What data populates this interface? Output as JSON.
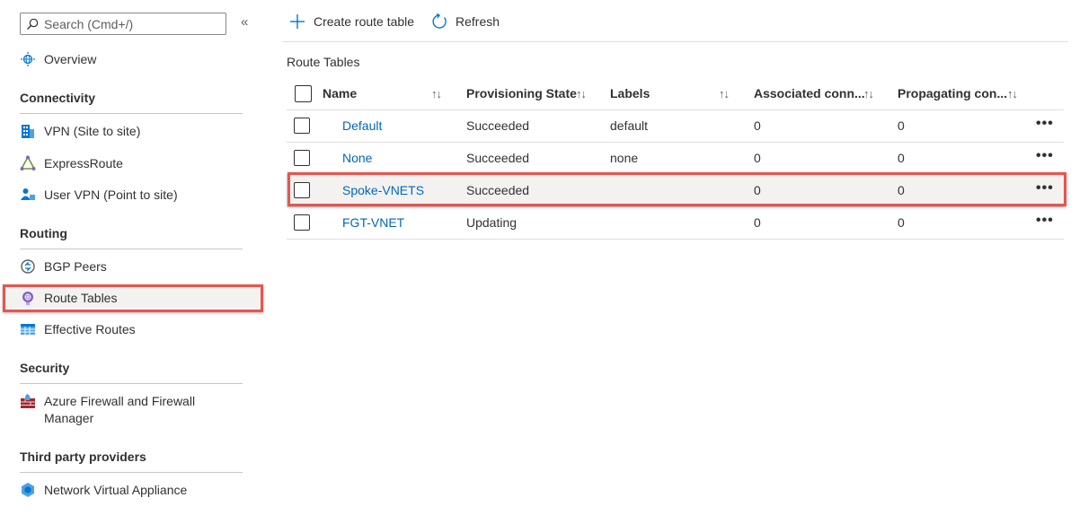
{
  "sidebar": {
    "search_placeholder": "Search (Cmd+/)",
    "collapse_glyph": "«",
    "overview": "Overview",
    "sections": {
      "connectivity": "Connectivity",
      "routing": "Routing",
      "security": "Security",
      "third_party": "Third party providers"
    },
    "items": {
      "vpn": "VPN (Site to site)",
      "expressroute": "ExpressRoute",
      "user_vpn": "User VPN (Point to site)",
      "bgp_peers": "BGP Peers",
      "route_tables": "Route Tables",
      "effective_routes": "Effective Routes",
      "firewall_line1": "Azure Firewall and Firewall",
      "firewall_line2": "Manager",
      "nva": "Network Virtual Appliance"
    },
    "selected_item": "route_tables"
  },
  "toolbar": {
    "create": "Create route table",
    "refresh": "Refresh"
  },
  "main": {
    "title": "Route Tables",
    "columns": {
      "name": "Name",
      "provisioning": "Provisioning State",
      "labels": "Labels",
      "associated": "Associated conn...",
      "propagating": "Propagating con..."
    },
    "sort_glyph": "↑↓",
    "more_glyph": "•••",
    "rows": [
      {
        "name": "Default",
        "state": "Succeeded",
        "labels": "default",
        "associated": "0",
        "propagating": "0"
      },
      {
        "name": "None",
        "state": "Succeeded",
        "labels": "none",
        "associated": "0",
        "propagating": "0"
      },
      {
        "name": "Spoke-VNETS",
        "state": "Succeeded",
        "labels": "",
        "associated": "0",
        "propagating": "0"
      },
      {
        "name": "FGT-VNET",
        "state": "Updating",
        "labels": "",
        "associated": "0",
        "propagating": "0"
      }
    ]
  },
  "colors": {
    "link": "#0067b8",
    "highlight_border": "#e8554e",
    "accent": "#0078d4"
  }
}
